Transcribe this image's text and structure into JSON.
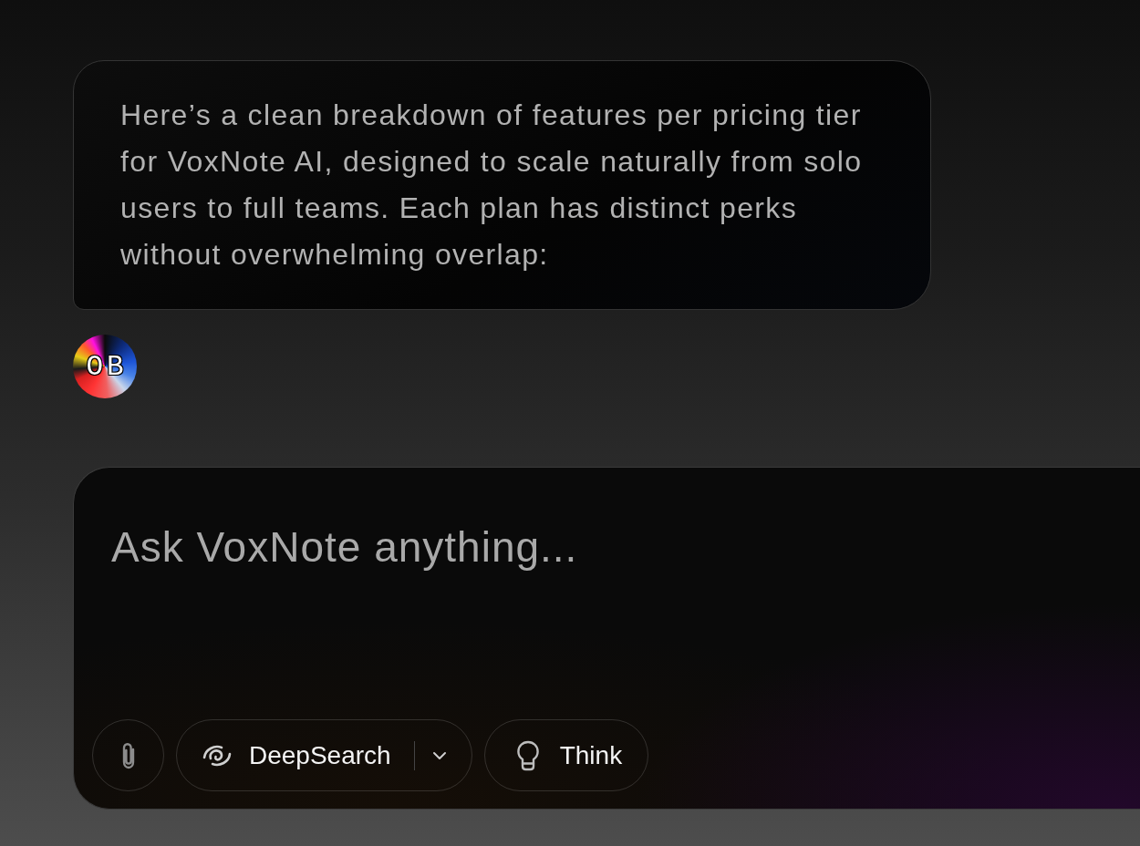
{
  "message": {
    "text": "Here’s a clean breakdown of features per pricing tier for VoxNote AI, designed to scale naturally from solo users to full teams. Each plan has distinct perks without overwhelming overlap:"
  },
  "avatar": {
    "initials": "OB"
  },
  "composer": {
    "placeholder": "Ask VoxNote anything...",
    "buttons": [
      {
        "kind": "attach"
      },
      {
        "kind": "deepsearch",
        "label": "DeepSearch",
        "dropdown": true
      },
      {
        "kind": "think",
        "label": "Think"
      }
    ]
  }
}
